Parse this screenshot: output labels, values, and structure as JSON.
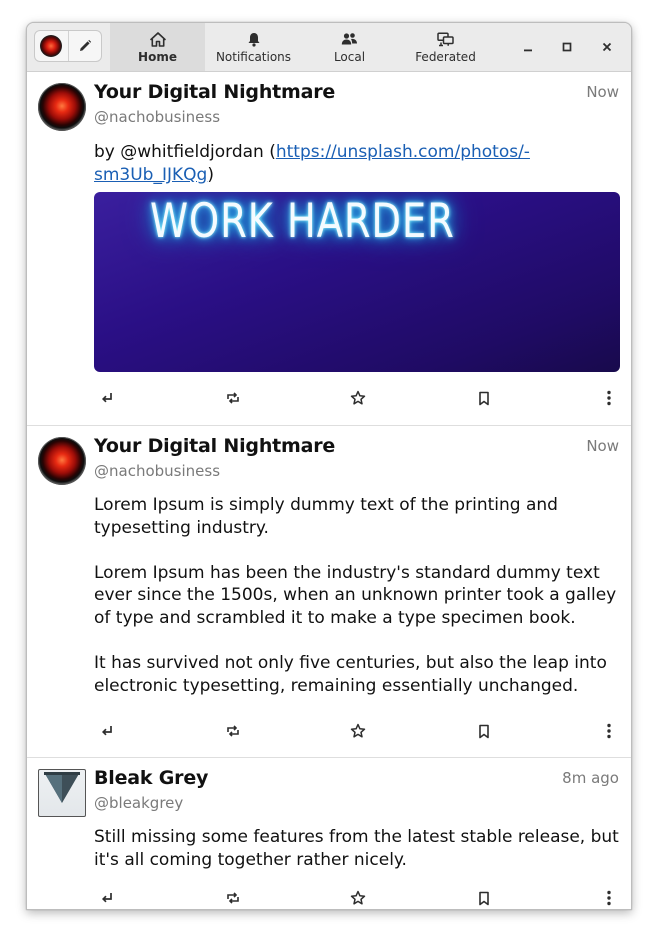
{
  "header": {
    "tabs": [
      {
        "label": "Home",
        "icon": "home-icon",
        "active": true
      },
      {
        "label": "Notifications",
        "icon": "bell-icon",
        "active": false
      },
      {
        "label": "Local",
        "icon": "people-icon",
        "active": false
      },
      {
        "label": "Federated",
        "icon": "network-icon",
        "active": false
      }
    ]
  },
  "posts": [
    {
      "name": "Your Digital Nightmare",
      "handle": "@nachobusiness",
      "time": "Now",
      "text_prefix": "by @whitfieldjordan (",
      "link_line1": "https://unsplash.com/photos/-",
      "link_line2": "sm3Ub_IJKQg",
      "text_suffix": ")",
      "media_text": "WORK HARDER"
    },
    {
      "name": "Your Digital Nightmare",
      "handle": "@nachobusiness",
      "time": "Now",
      "paragraphs": [
        "Lorem Ipsum is simply dummy text of the printing and typesetting industry.",
        "Lorem Ipsum has been the industry's standard dummy text ever since the 1500s, when an unknown printer took a galley of type and scrambled it to make a type specimen book.",
        "It has survived not only five centuries, but also the leap into electronic typesetting, remaining essentially unchanged."
      ]
    },
    {
      "name": "Bleak Grey",
      "handle": "@bleakgrey",
      "time": "8m ago",
      "paragraphs": [
        "Still missing some features from the latest stable release, but it's all coming together rather nicely."
      ]
    }
  ],
  "colors": {
    "link": "#1a5fb4",
    "header_bg": "#ebebeb",
    "active_tab_bg": "#dcdcdc"
  }
}
